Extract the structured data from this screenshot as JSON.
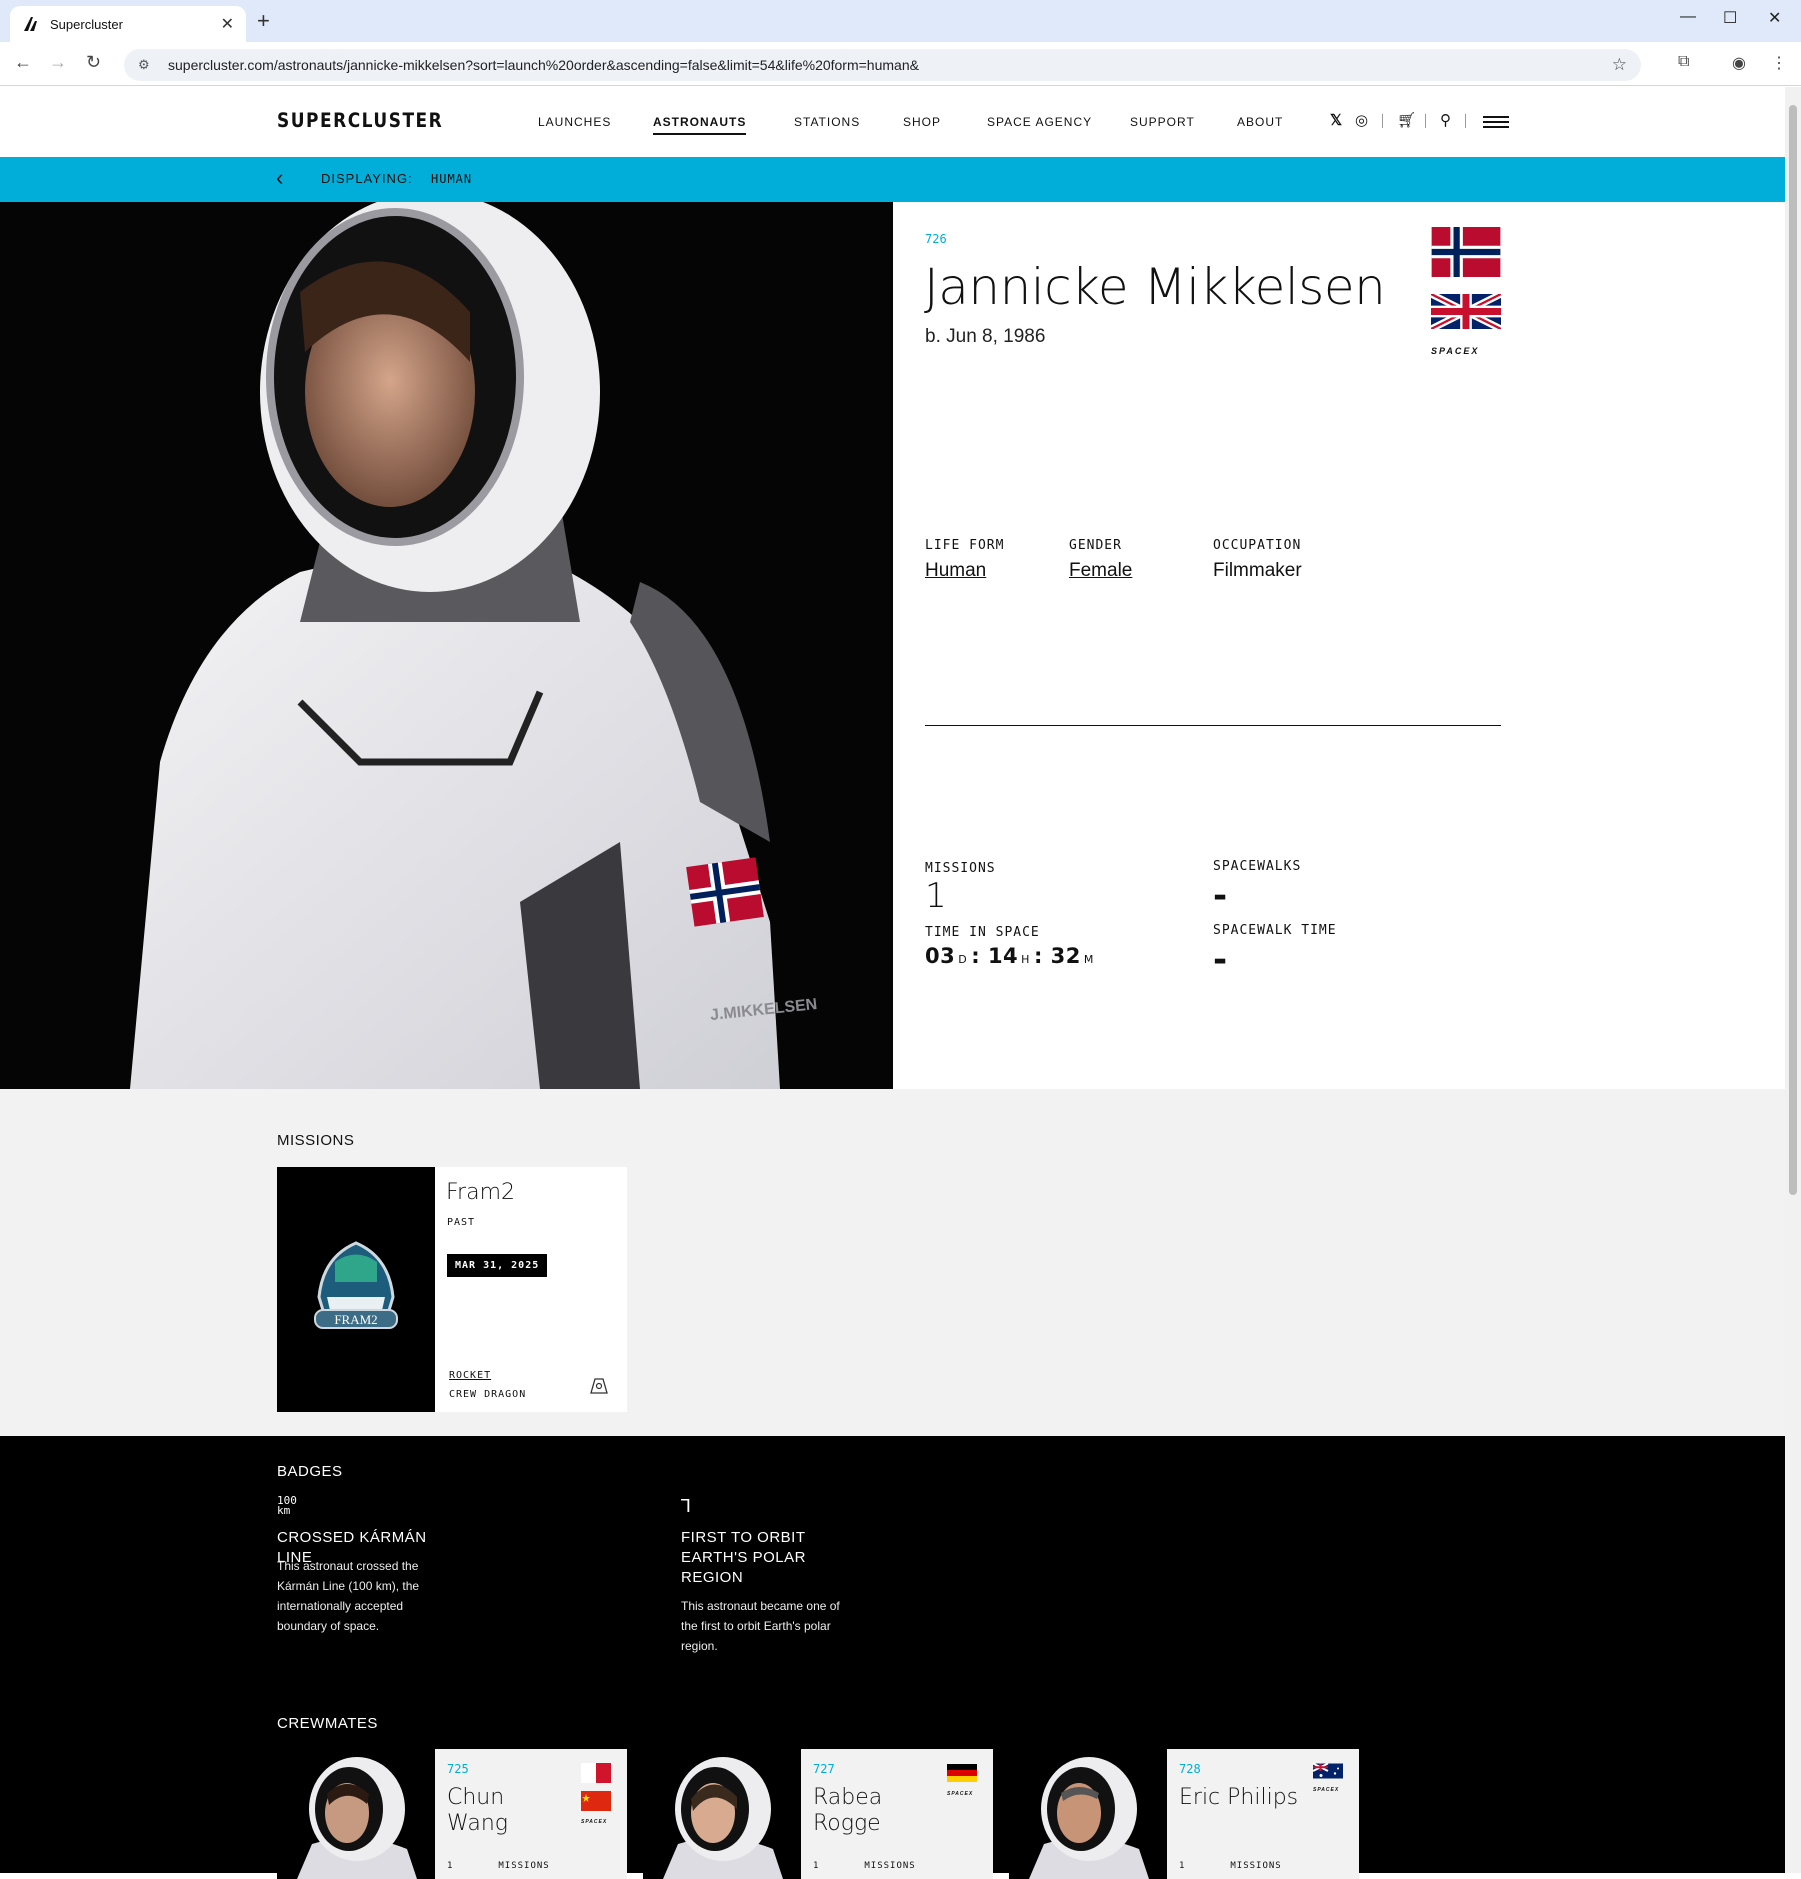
{
  "browser": {
    "tab_title": "Supercluster",
    "url": "supercluster.com/astronauts/jannicke-mikkelsen?sort=launch%20order&ascending=false&limit=54&life%20form=human&"
  },
  "header": {
    "logo": "SUPERCLUSTER",
    "nav": [
      "LAUNCHES",
      "ASTRONAUTS",
      "STATIONS",
      "SHOP",
      "SPACE AGENCY",
      "SUPPORT",
      "ABOUT"
    ],
    "active_nav": "ASTRONAUTS"
  },
  "filter_bar": {
    "label": "DISPLAYING:",
    "value": "HUMAN"
  },
  "astronaut": {
    "number": "726",
    "name": "Jannicke Mikkelsen",
    "born": "b. Jun 8, 1986",
    "agency": "SPACEX",
    "flags": [
      "Norway",
      "United Kingdom"
    ],
    "suit_label": "J.MIKKELSEN",
    "attributes": {
      "life_form_label": "LIFE FORM",
      "life_form": "Human",
      "gender_label": "GENDER",
      "gender": "Female",
      "occupation_label": "OCCUPATION",
      "occupation": "Filmmaker"
    },
    "stats": {
      "missions_label": "MISSIONS",
      "missions": "1",
      "spacewalks_label": "SPACEWALKS",
      "spacewalks": "-",
      "time_label": "TIME IN SPACE",
      "time_days": "03",
      "time_hours": "14",
      "time_minutes": "32",
      "unit_d": "D",
      "unit_h": "H",
      "unit_m": "M",
      "spacewalk_time_label": "SPACEWALK TIME",
      "spacewalk_time": "-"
    }
  },
  "missions": {
    "title": "MISSIONS",
    "items": [
      {
        "name": "Fram2",
        "status": "PAST",
        "date": "MAR 31, 2025",
        "rocket_label": "ROCKET",
        "vehicle": "CREW DRAGON",
        "patch_text": "FRAM2"
      }
    ]
  },
  "badges": {
    "title": "BADGES",
    "items": [
      {
        "icon_text": "100 km",
        "title": "CROSSED KÁRMÁN LINE",
        "desc": "This astronaut crossed the Kármán Line (100 km), the internationally accepted boundary of space."
      },
      {
        "icon_text": "⅂",
        "title": "FIRST TO ORBIT EARTH'S POLAR REGION",
        "desc": "This astronaut became one of the first to orbit Earth's polar region."
      }
    ]
  },
  "crewmates": {
    "title": "CREWMATES",
    "items": [
      {
        "number": "725",
        "name": "Chun Wang",
        "missions_count": "1",
        "missions_label": "MISSIONS"
      },
      {
        "number": "727",
        "name": "Rabea Rogge",
        "missions_count": "1",
        "missions_label": "MISSIONS"
      },
      {
        "number": "728",
        "name": "Eric Philips",
        "missions_count": "1",
        "missions_label": "MISSIONS"
      }
    ]
  },
  "colors": {
    "accent": "#00aed9",
    "dark": "#000000",
    "light_gray": "#f2f2f2"
  }
}
